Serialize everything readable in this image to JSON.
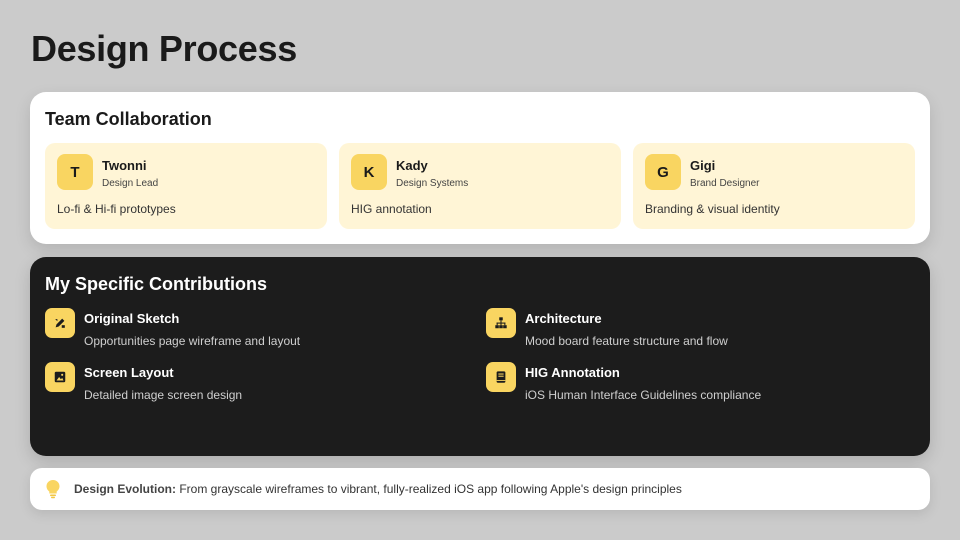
{
  "page": {
    "title": "Design Process"
  },
  "team": {
    "title": "Team Collaboration",
    "members": [
      {
        "initial": "T",
        "name": "Twonni",
        "role": "Design Lead",
        "task": "Lo-fi & Hi-fi prototypes"
      },
      {
        "initial": "K",
        "name": "Kady",
        "role": "Design Systems",
        "task": "HIG annotation"
      },
      {
        "initial": "G",
        "name": "Gigi",
        "role": "Brand Designer",
        "task": "Branding & visual identity"
      }
    ]
  },
  "contributions": {
    "title": "My Specific Contributions",
    "items": [
      {
        "icon": "pencil-ruler-icon",
        "title": "Original Sketch",
        "desc": "Opportunities page wireframe and layout"
      },
      {
        "icon": "sitemap-icon",
        "title": "Architecture",
        "desc": "Mood board feature structure and flow"
      },
      {
        "icon": "image-icon",
        "title": "Screen Layout",
        "desc": "Detailed image screen design"
      },
      {
        "icon": "book-icon",
        "title": "HIG Annotation",
        "desc": "iOS Human Interface Guidelines compliance"
      }
    ]
  },
  "evolution": {
    "icon": "lightbulb-icon",
    "label": "Design Evolution:",
    "text": " From grayscale wireframes to vibrant, fully-realized iOS app following Apple's design principles"
  },
  "colors": {
    "background": "#cbcbcb",
    "accent": "#f9d561",
    "member_card": "#fff5d6",
    "dark_card": "#1c1c1c"
  }
}
